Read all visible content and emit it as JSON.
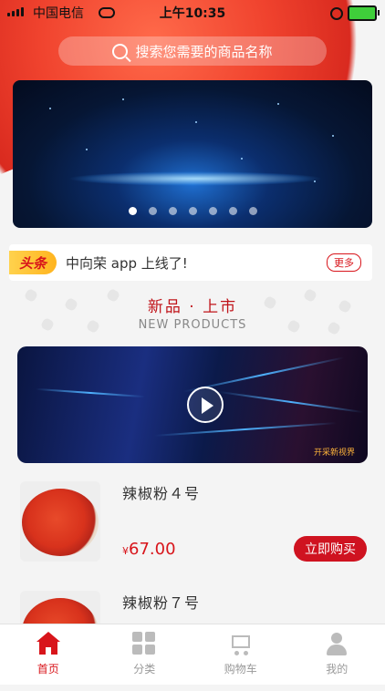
{
  "status_bar": {
    "carrier": "中国电信",
    "time": "上午10:35"
  },
  "search": {
    "placeholder": "搜索您需要的商品名称"
  },
  "banner": {
    "slide_count": 7,
    "active_index": 0
  },
  "news": {
    "tag": "头条",
    "text": "中向荣 app 上线了!",
    "more_label": "更多"
  },
  "section": {
    "title_zh": "新品 · 上市",
    "title_en": "NEW PRODUCTS"
  },
  "video": {
    "caption": "开采新视界"
  },
  "products": [
    {
      "name": "辣椒粉４号",
      "currency": "¥",
      "price": "67.00",
      "buy_label": "立即购买"
    },
    {
      "name": "辣椒粉７号",
      "currency": "¥",
      "price": "",
      "buy_label": ""
    }
  ],
  "tabbar": {
    "items": [
      {
        "label": "首页",
        "icon": "home-icon",
        "active": true
      },
      {
        "label": "分类",
        "icon": "category-grid-icon",
        "active": false
      },
      {
        "label": "购物车",
        "icon": "cart-icon",
        "active": false
      },
      {
        "label": "我的",
        "icon": "user-icon",
        "active": false
      }
    ]
  },
  "colors": {
    "brand_red": "#d8151b",
    "buy_button": "#cf1320",
    "tag_yellow": "#ffb41f"
  }
}
